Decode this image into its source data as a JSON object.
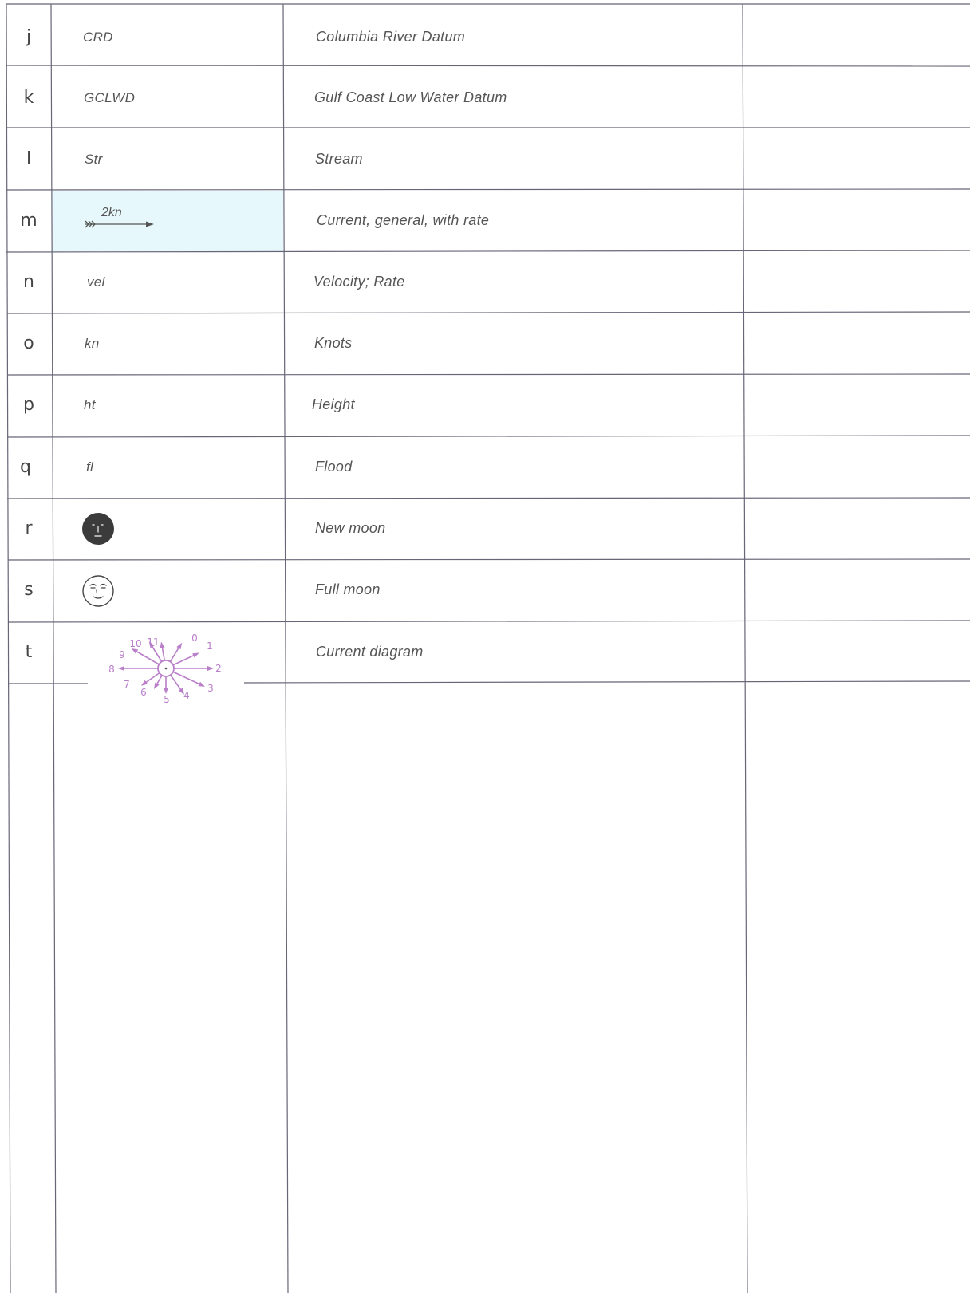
{
  "rows": [
    {
      "letter": "j",
      "symbol": "CRD",
      "description": "Columbia River Datum"
    },
    {
      "letter": "k",
      "symbol": "GCLWD",
      "description": "Gulf Coast Low Water Datum"
    },
    {
      "letter": "l",
      "symbol": "Str",
      "description": "Stream"
    },
    {
      "letter": "m",
      "symbol": "2kn",
      "description": "Current, general, with rate"
    },
    {
      "letter": "n",
      "symbol": "vel",
      "description": "Velocity; Rate"
    },
    {
      "letter": "o",
      "symbol": "kn",
      "description": "Knots"
    },
    {
      "letter": "p",
      "symbol": "ht",
      "description": "Height"
    },
    {
      "letter": "q",
      "symbol": "fl",
      "description": "Flood"
    },
    {
      "letter": "r",
      "symbol": "",
      "description": "New moon"
    },
    {
      "letter": "s",
      "symbol": "",
      "description": "Full moon"
    },
    {
      "letter": "t",
      "symbol": "",
      "description": "Current diagram"
    }
  ],
  "current_diagram": {
    "labels": [
      "0",
      "1",
      "2",
      "3",
      "4",
      "5",
      "6",
      "7",
      "8",
      "9",
      "10",
      "11"
    ],
    "color": "#b97fc9"
  },
  "colors": {
    "highlight": "#e6f8fb",
    "rule": "#666677",
    "moon_dark": "#3b3b3b"
  },
  "icons": {
    "row_m": "current-arrow-icon",
    "row_r": "new-moon-icon",
    "row_s": "full-moon-icon",
    "row_t": "current-diagram-icon"
  }
}
